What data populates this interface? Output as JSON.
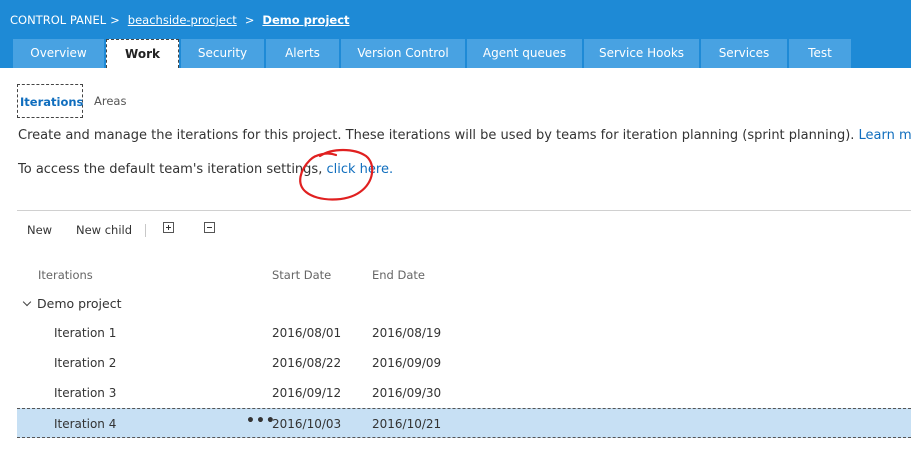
{
  "breadcrumb": {
    "root": "CONTROL PANEL",
    "separator": ">",
    "collection": "beachside-procject",
    "project": "Demo project"
  },
  "tabs": [
    {
      "label": "Overview"
    },
    {
      "label": "Work",
      "active": true
    },
    {
      "label": "Security"
    },
    {
      "label": "Alerts"
    },
    {
      "label": "Version Control"
    },
    {
      "label": "Agent queues"
    },
    {
      "label": "Service Hooks"
    },
    {
      "label": "Services"
    },
    {
      "label": "Test"
    }
  ],
  "subtabs": {
    "active": "Iterations",
    "other": "Areas"
  },
  "description": {
    "text": "Create and manage the iterations for this project. These iterations will be used by teams for iteration planning (sprint planning).",
    "link": "Learn more",
    "link_icon": "external-link-icon"
  },
  "access": {
    "text": "To access the default team's iteration settings,",
    "link": "click here."
  },
  "annotation_color": "#e02020",
  "toolbar": {
    "new_label": "New",
    "new_child_label": "New child",
    "expand_icon": "expand-all-icon",
    "collapse_icon": "collapse-all-icon"
  },
  "grid": {
    "columns": {
      "iterations": "Iterations",
      "start": "Start Date",
      "end": "End Date"
    },
    "root": "Demo project",
    "rows": [
      {
        "name": "Iteration 1",
        "start": "2016/08/01",
        "end": "2016/08/19"
      },
      {
        "name": "Iteration 2",
        "start": "2016/08/22",
        "end": "2016/09/09"
      },
      {
        "name": "Iteration 3",
        "start": "2016/09/12",
        "end": "2016/09/30"
      },
      {
        "name": "Iteration 4",
        "start": "2016/10/03",
        "end": "2016/10/21",
        "selected": true
      }
    ],
    "context_menu": "•••"
  },
  "colors": {
    "header_bg": "#1e8ad6",
    "tab_bg": "#48a2e2",
    "link": "#106ebe",
    "selected_row": "#c7e0f4"
  }
}
